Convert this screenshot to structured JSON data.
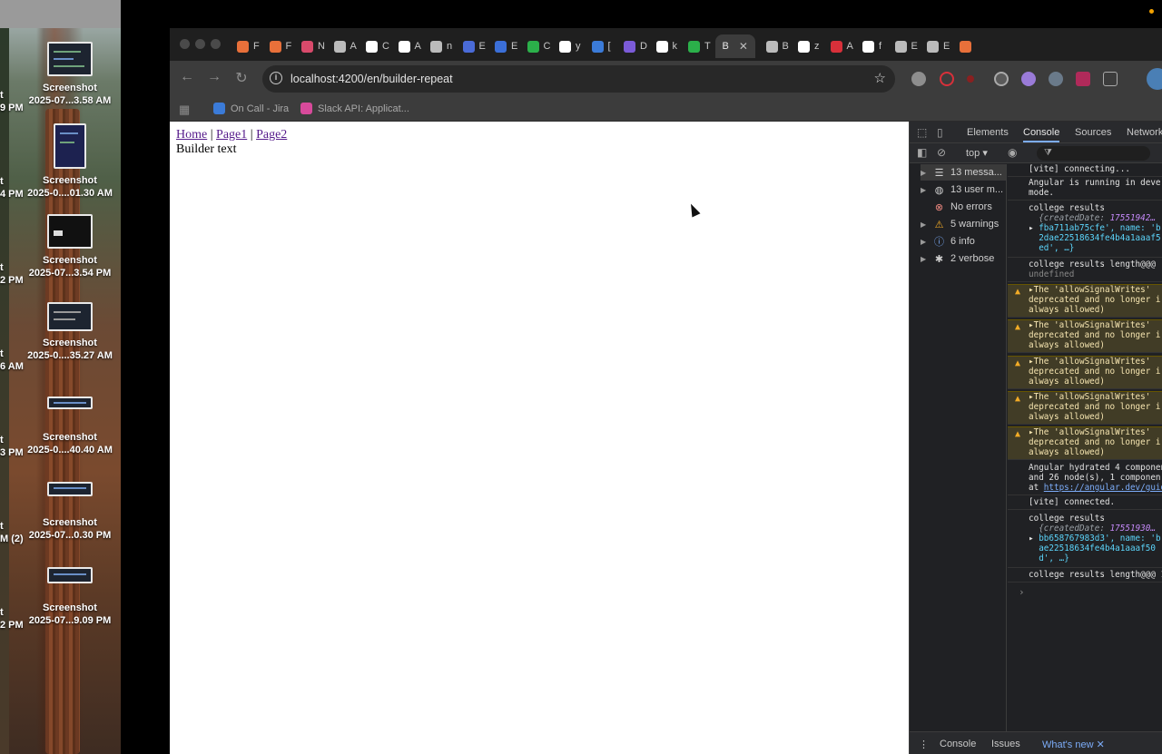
{
  "desktop": {
    "items": [
      {
        "label_1": "Screenshot",
        "label_2": "2025-07...3.58 AM",
        "cut": "9 PM"
      },
      {
        "label_1": "Screenshot",
        "label_2": "2025-0....01.30 AM",
        "cut": "4 PM"
      },
      {
        "label_1": "Screenshot",
        "label_2": "2025-07...3.54 PM",
        "cut": "2 PM"
      },
      {
        "label_1": "Screenshot",
        "label_2": "2025-0....35.27 AM",
        "cut": "6 AM"
      },
      {
        "label_1": "Screenshot",
        "label_2": "2025-0....40.40 AM",
        "cut": "3 PM"
      },
      {
        "label_1": "Screenshot",
        "label_2": "2025-07...0.30 PM",
        "cut": "M (2)"
      },
      {
        "label_1": "Screenshot",
        "label_2": "2025-07...9.09 PM",
        "cut": "2 PM"
      }
    ],
    "cut_t": "t"
  },
  "browser": {
    "tabs": [
      {
        "label": "F",
        "color": "#e8703a"
      },
      {
        "label": "F",
        "color": "#e8703a"
      },
      {
        "label": "N",
        "color": "#d84a6b"
      },
      {
        "label": "A",
        "color": "#bbbbbb"
      },
      {
        "label": "C",
        "color": "#ffffff"
      },
      {
        "label": "A",
        "color": "#ffffff"
      },
      {
        "label": "n",
        "color": "#bbbbbb"
      },
      {
        "label": "E",
        "color": "#4a6bd8"
      },
      {
        "label": "E",
        "color": "#3b6fd8"
      },
      {
        "label": "C",
        "color": "#2bb04a"
      },
      {
        "label": "y",
        "color": "#ffffff"
      },
      {
        "label": "[",
        "color": "#3b7bd8"
      },
      {
        "label": "D",
        "color": "#7b5bd8"
      },
      {
        "label": "k",
        "color": "#ffffff"
      },
      {
        "label": "T",
        "color": "#2bb04a"
      },
      {
        "label": "B",
        "color": "#bbbbbb",
        "active": true
      },
      {
        "label": "B",
        "color": "#bbbbbb"
      },
      {
        "label": "z",
        "color": "#ffffff"
      },
      {
        "label": "A",
        "color": "#d8303a"
      },
      {
        "label": "f",
        "color": "#ffffff"
      },
      {
        "label": "E",
        "color": "#bbbbbb"
      },
      {
        "label": "E",
        "color": "#bbbbbb"
      },
      {
        "label": "",
        "color": "#e8703a"
      }
    ],
    "url": "localhost:4200/en/builder-repeat",
    "bookmarks": [
      {
        "label": "On Call - Jira",
        "color": "#3b7bd8"
      },
      {
        "label": "Slack API: Applicat...",
        "color": "#d84a9b"
      }
    ]
  },
  "page": {
    "links": [
      "Home",
      "Page1",
      "Page2"
    ],
    "separator": "|",
    "text": "Builder text"
  },
  "devtools": {
    "tabs": [
      "Elements",
      "Console",
      "Sources",
      "Network"
    ],
    "context": "top ▾",
    "sidebar": [
      {
        "label": "13 messa...",
        "icon": "list-icon",
        "selected": true
      },
      {
        "label": "13 user m...",
        "icon": "user-icon"
      },
      {
        "label": "No errors",
        "icon": "error-icon"
      },
      {
        "label": "5 warnings",
        "icon": "warning-icon"
      },
      {
        "label": "6 info",
        "icon": "info-icon"
      },
      {
        "label": "2 verbose",
        "icon": "bug-icon"
      }
    ],
    "console": {
      "vite_connecting": "[vite] connecting...",
      "angular_dev_1": "Angular is running in deve",
      "angular_dev_2": "mode.",
      "college_results": "college results",
      "obj1_line1_key": "{createdDate: ",
      "obj1_line1_val": "17551942…",
      "obj1_line2": "fba711ab75cfe', name: 'b",
      "obj1_line3": "2dae22518634fe4b4a1aaaf5",
      "obj1_line4": "ed', …}",
      "college_length": "college results length@@@",
      "undefined": "undefined",
      "warn_line1": "The 'allowSignalWrites' ",
      "warn_line2": "deprecated and no longer i",
      "warn_line3": "always allowed)",
      "hydrated_1": "Angular hydrated 4 componen",
      "hydrated_2": "and 26 node(s), 1 componen",
      "hydrated_3": "at ",
      "hydrated_link": "https://angular.dev/guid",
      "vite_connected": "[vite] connected.",
      "obj2_line1_key": "{createdDate: ",
      "obj2_line1_val": "17551930…",
      "obj2_line2": "bb658767983d3', name: 'b",
      "obj2_line3": "ae22518634fe4b4a1aaaf50",
      "obj2_line4": "d', …}",
      "college_length_2": "college results length@@@ 1"
    },
    "drawer": [
      "Console",
      "Issues",
      "What's new ✕"
    ]
  }
}
